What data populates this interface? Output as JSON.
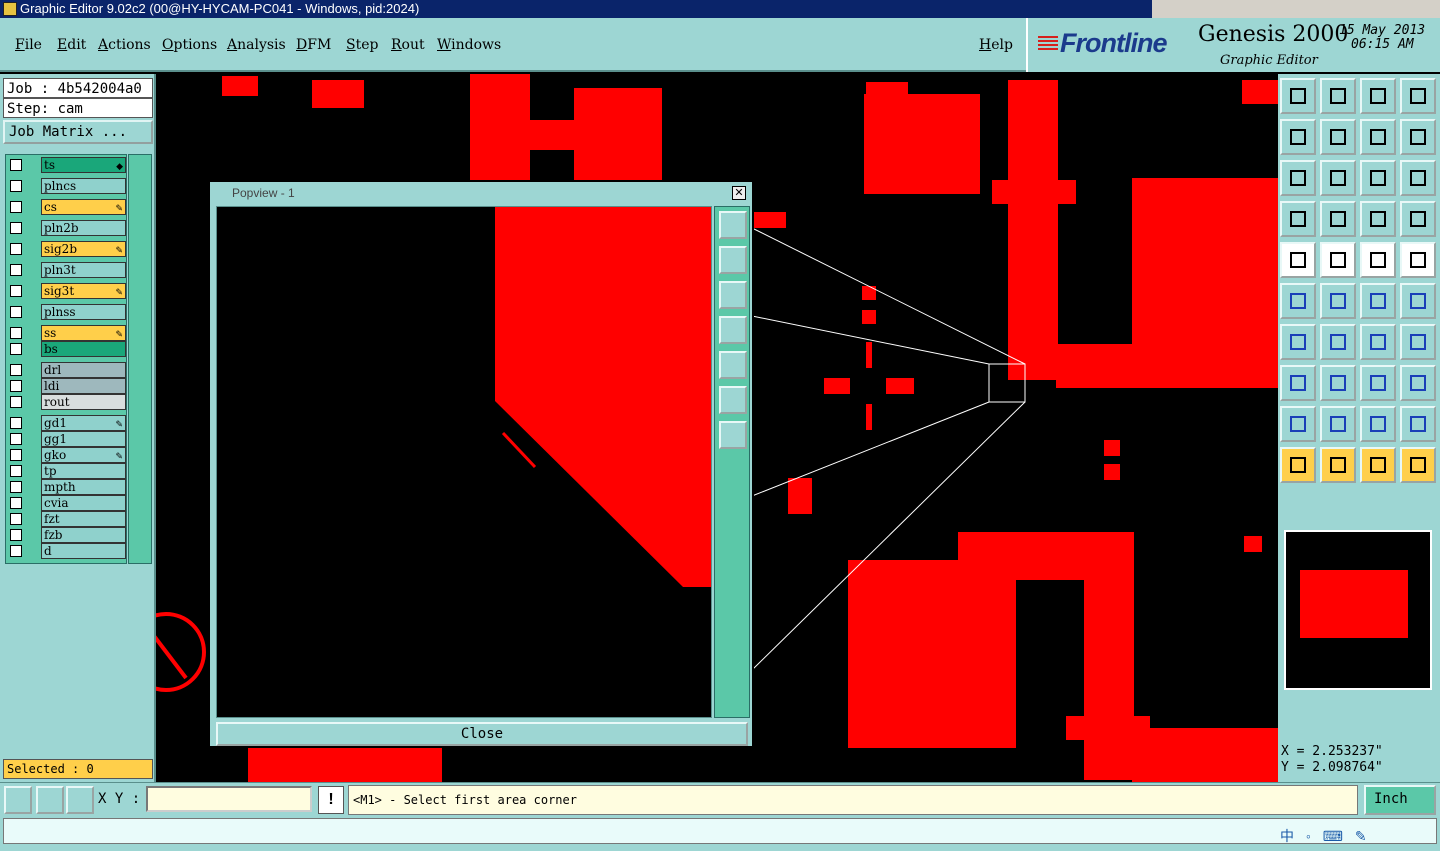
{
  "window": {
    "title": "Graphic Editor 9.02c2 (00@HY-HYCAM-PC041 - Windows, pid:2024)"
  },
  "menu": [
    "File",
    "Edit",
    "Actions",
    "Options",
    "Analysis",
    "DFM",
    "Step",
    "Rout",
    "Windows"
  ],
  "help_label": "Help",
  "brand": {
    "logo": "Frontline",
    "product": "Genesis 2000",
    "subtitle": "Graphic Editor",
    "date": "15 May 2013",
    "time": "06:15 AM"
  },
  "job": {
    "job_line": "Job : 4b542004a0",
    "step_line": "Step: cam",
    "matrix_button": "Job Matrix ..."
  },
  "layers": [
    {
      "name": "ts",
      "color": "#1aa77a",
      "mark": "◆"
    },
    {
      "name": "plncs",
      "color": "#8fd1cc",
      "mark": ""
    },
    {
      "name": "cs",
      "color": "#ffcf4a",
      "mark": "✎"
    },
    {
      "name": "pln2b",
      "color": "#8fd1cc",
      "mark": ""
    },
    {
      "name": "sig2b",
      "color": "#ffcf4a",
      "mark": "✎"
    },
    {
      "name": "pln3t",
      "color": "#8fd1cc",
      "mark": ""
    },
    {
      "name": "sig3t",
      "color": "#ffcf4a",
      "mark": "✎"
    },
    {
      "name": "plnss",
      "color": "#8fd1cc",
      "mark": ""
    },
    {
      "name": "ss",
      "color": "#ffcf4a",
      "mark": "✎"
    },
    {
      "name": "bs",
      "color": "#1aa77a",
      "mark": ""
    },
    {
      "name": "drl",
      "color": "#9eb8bd",
      "mark": ""
    },
    {
      "name": "ldi",
      "color": "#9eb8bd",
      "mark": ""
    },
    {
      "name": "rout",
      "color": "#d9dede",
      "mark": ""
    },
    {
      "name": "gd1",
      "color": "#8fd1cc",
      "mark": "✎"
    },
    {
      "name": "gg1",
      "color": "#8fd1cc",
      "mark": ""
    },
    {
      "name": "gko",
      "color": "#8fd1cc",
      "mark": "✎"
    },
    {
      "name": "tp",
      "color": "#8fd1cc",
      "mark": ""
    },
    {
      "name": "mpth",
      "color": "#8fd1cc",
      "mark": ""
    },
    {
      "name": "cvia",
      "color": "#8fd1cc",
      "mark": ""
    },
    {
      "name": "fzt",
      "color": "#8fd1cc",
      "mark": ""
    },
    {
      "name": "fzb",
      "color": "#8fd1cc",
      "mark": ""
    },
    {
      "name": "d",
      "color": "#8fd1cc",
      "mark": ""
    }
  ],
  "selected_text": "Selected : 0",
  "popview": {
    "title": "Popview - 1",
    "close_label": "Close",
    "close_x": "✕"
  },
  "coords": {
    "x": "X = 2.253237\"",
    "y": "Y = 2.098764\""
  },
  "toolbar_icons": [
    "layer-up-icon",
    "layer-down-icon",
    "home-icon",
    "window-icon",
    "pan-left-icon",
    "pan-right-icon",
    "undo-icon",
    "redo-icon",
    "zoom-fit-icon",
    "zoom-center-icon",
    "one-to-one-icon",
    "help-icon",
    "tools-icon",
    "grid-icon",
    "snap-icon",
    "snap-off-icon",
    "pad-icon",
    "draw-icon",
    "measure-icon",
    "circle-icon",
    "net-icon",
    "cross-icon",
    "line-icon",
    "arc-icon",
    "angle-icon",
    "slash-icon",
    "rotate-icon",
    "filter-icon",
    "select-icon",
    "cut-icon",
    "target-icon",
    "group-icon",
    "triangle-icon",
    "mirror-icon",
    "frame-icon",
    "slope-icon",
    "pointer-icon",
    "pointer-select-icon",
    "pointer-box-icon",
    "pointer-route-icon"
  ],
  "bottom": {
    "xy_label": "X Y :",
    "xy_value": "",
    "message": "<M1> - Select first area corner",
    "unit": "Inch",
    "excl": "!"
  },
  "tray": "中 ◦ ⌨ ✎"
}
